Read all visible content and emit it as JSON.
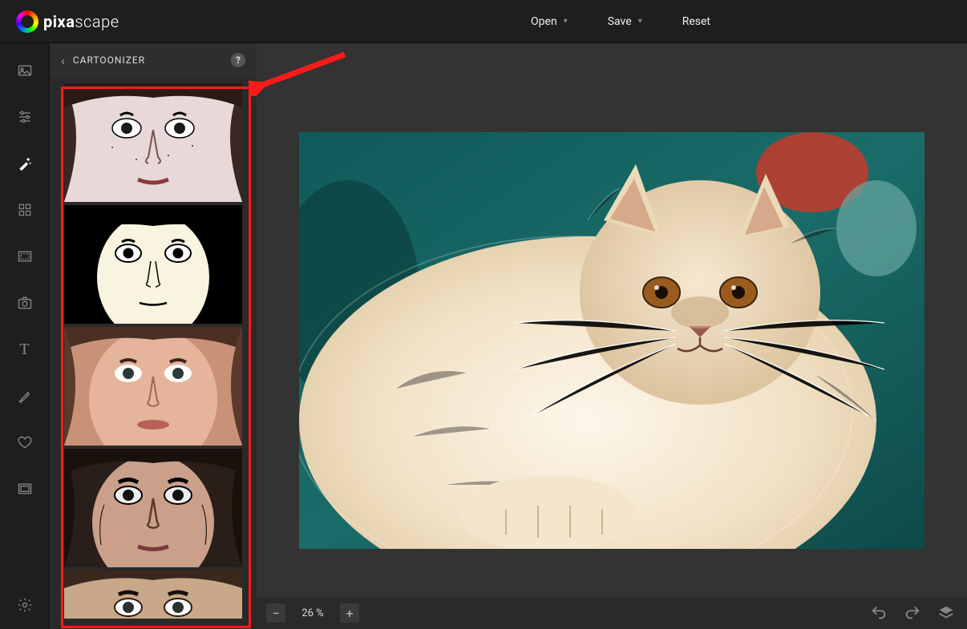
{
  "app": {
    "logo_bold": "pixa",
    "logo_light": "scape"
  },
  "menu": {
    "open": "Open",
    "save": "Save",
    "reset": "Reset"
  },
  "panel": {
    "title": "CARTOONIZER"
  },
  "tools": [
    {
      "name": "image-tool"
    },
    {
      "name": "adjust-tool"
    },
    {
      "name": "effects-tool",
      "active": true
    },
    {
      "name": "grid-tool"
    },
    {
      "name": "border-tool"
    },
    {
      "name": "camera-tool"
    },
    {
      "name": "text-tool"
    },
    {
      "name": "brush-tool"
    },
    {
      "name": "heart-tool"
    },
    {
      "name": "frame-tool"
    }
  ],
  "presets": [
    {
      "name": "cartoon-preset-1"
    },
    {
      "name": "cartoon-preset-2"
    },
    {
      "name": "cartoon-preset-3"
    },
    {
      "name": "cartoon-preset-4"
    },
    {
      "name": "cartoon-preset-5"
    }
  ],
  "zoom": {
    "level_label": "26 %"
  }
}
